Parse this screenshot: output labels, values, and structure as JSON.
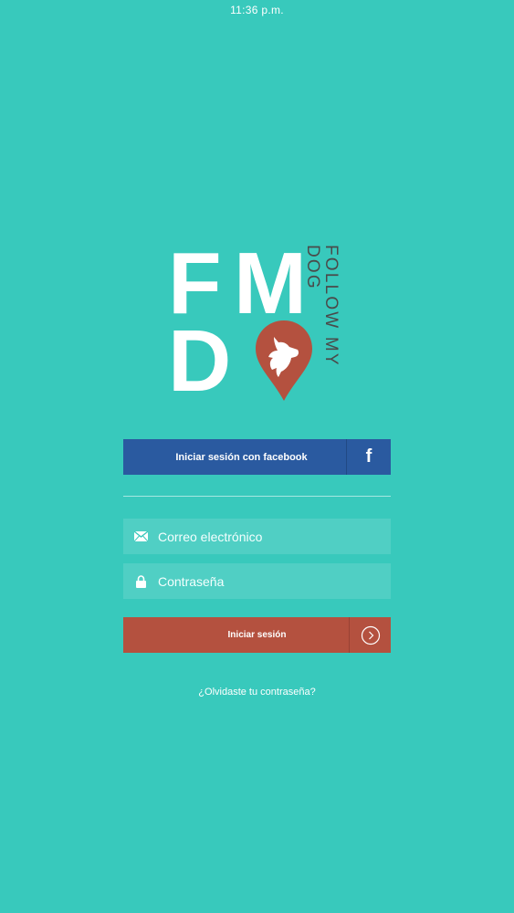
{
  "status_bar": {
    "time": "11:36 p.m."
  },
  "logo": {
    "letter_f": "F",
    "letter_m": "M",
    "letter_d": "D",
    "tagline": "FOLLOW MY DOG",
    "pin_color": "#b4513f"
  },
  "facebook_button": {
    "label": "Iniciar sesión con facebook",
    "icon_glyph": "f",
    "color": "#2a5aa0"
  },
  "email_field": {
    "placeholder": "Correo electrónico",
    "icon": "envelope-icon"
  },
  "password_field": {
    "placeholder": "Contraseña",
    "icon": "lock-icon"
  },
  "login_button": {
    "label": "Iniciar sesión",
    "icon": "chevron-right-circle-icon",
    "color": "#b4513f"
  },
  "forgot_password": {
    "label": "¿Olvidaste tu contraseña?"
  },
  "colors": {
    "background": "#38c9bc"
  }
}
